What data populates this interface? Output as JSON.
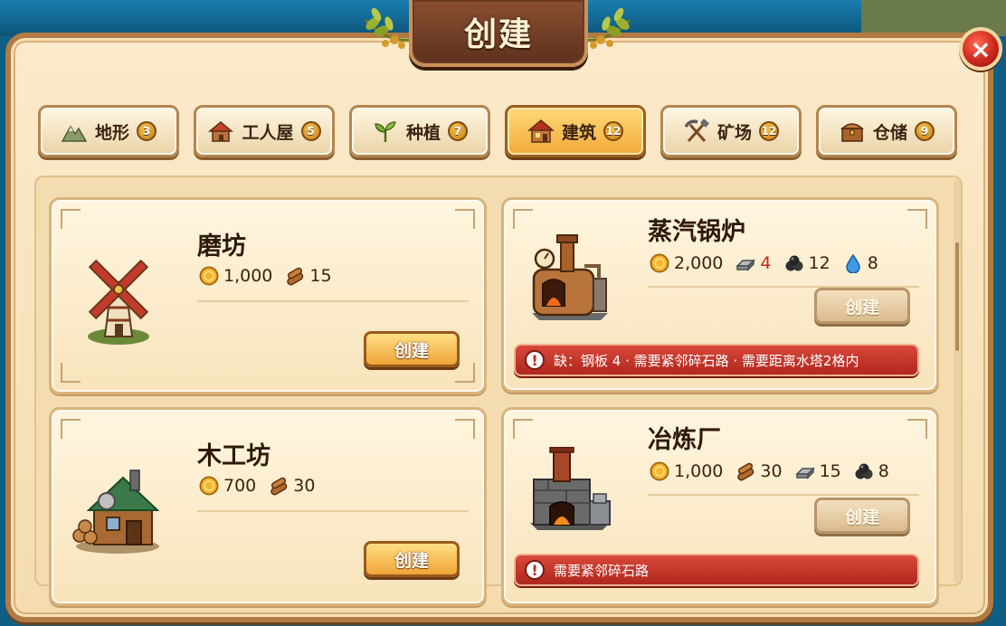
{
  "title": "创建",
  "close_icon": "×",
  "tabs": [
    {
      "label": "地形",
      "badge": "3",
      "icon": "terrain-icon",
      "active": false
    },
    {
      "label": "工人屋",
      "badge": "5",
      "icon": "worker-house-icon",
      "active": false
    },
    {
      "label": "种植",
      "badge": "7",
      "icon": "sprout-icon",
      "active": false
    },
    {
      "label": "建筑",
      "badge": "12",
      "icon": "building-icon",
      "active": true
    },
    {
      "label": "矿场",
      "badge": "12",
      "icon": "pickaxe-icon",
      "active": false
    },
    {
      "label": "仓储",
      "badge": "9",
      "icon": "chest-icon",
      "active": false
    }
  ],
  "cards": [
    {
      "name": "磨坊",
      "image": "windmill-icon",
      "costs": [
        {
          "icon": "coin-icon",
          "value": "1,000"
        },
        {
          "icon": "wood-icon",
          "value": "15"
        }
      ],
      "button": "创建",
      "enabled": true
    },
    {
      "name": "蒸汽锅炉",
      "image": "steam-boiler-icon",
      "costs": [
        {
          "icon": "coin-icon",
          "value": "2,000"
        },
        {
          "icon": "steel-plate-icon",
          "value": "4",
          "lacking": true
        },
        {
          "icon": "coal-icon",
          "value": "12"
        },
        {
          "icon": "water-icon",
          "value": "8"
        }
      ],
      "button": "创建",
      "enabled": false,
      "warning": "缺：钢板 4 · 需要紧邻碎石路 · 需要距离水塔2格内"
    },
    {
      "name": "木工坊",
      "image": "carpentry-icon",
      "costs": [
        {
          "icon": "coin-icon",
          "value": "700"
        },
        {
          "icon": "wood-icon",
          "value": "30"
        }
      ],
      "button": "创建",
      "enabled": true
    },
    {
      "name": "冶炼厂",
      "image": "smelter-icon",
      "costs": [
        {
          "icon": "coin-icon",
          "value": "1,000"
        },
        {
          "icon": "wood-icon",
          "value": "30"
        },
        {
          "icon": "steel-plate-icon",
          "value": "15"
        },
        {
          "icon": "coal-icon",
          "value": "8"
        }
      ],
      "button": "创建",
      "enabled": false,
      "warning": "需要紧邻碎石路"
    }
  ],
  "colors": {
    "panel": "#fbeacb",
    "active_tab": "#f2a93a",
    "warning": "#c22a18",
    "close": "#c8231a"
  }
}
